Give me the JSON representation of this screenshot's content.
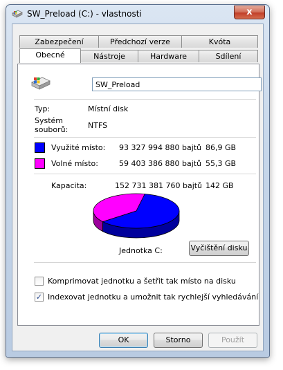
{
  "window": {
    "title": "SW_Preload (C:) - vlastnosti",
    "close_glyph": "x"
  },
  "tabs_row1": [
    "Zabezpečení",
    "Předchozí verze",
    "Kvóta"
  ],
  "tabs_row2": [
    "Obecné",
    "Nástroje",
    "Hardware",
    "Sdílení"
  ],
  "active_tab": "Obecné",
  "general": {
    "drive_name": "SW_Preload",
    "type_label": "Typ:",
    "type_value": "Místní disk",
    "fs_label_line1": "Systém",
    "fs_label_line2": "souborů:",
    "fs_value": "NTFS",
    "used": {
      "label": "Využité místo:",
      "bytes": "93 327 994 880 bajtů",
      "size": "86,9 GB",
      "color": "#0000ff"
    },
    "free": {
      "label": "Volné místo:",
      "bytes": "59 403 386 880 bajtů",
      "size": "55,3 GB",
      "color": "#ff00ff"
    },
    "capacity": {
      "label": "Kapacita:",
      "bytes": "152 731 381 760 bajtů",
      "size": "142 GB"
    },
    "used_fraction": 0.611,
    "drive_label": "Jednotka C:",
    "cleanup_button": "Vyčištění disku",
    "compress_label": "Komprimovat jednotku a šetřit tak místo na disku",
    "compress_checked": false,
    "index_label": "Indexovat jednotku a umožnit tak rychlejší vyhledávání",
    "index_checked": true,
    "check_glyph": "✓"
  },
  "buttons": {
    "ok": "OK",
    "cancel": "Storno",
    "apply": "Použít"
  },
  "icons": {
    "window_icon": "drive-icon",
    "drive_icon": "hard-drive-icon"
  }
}
